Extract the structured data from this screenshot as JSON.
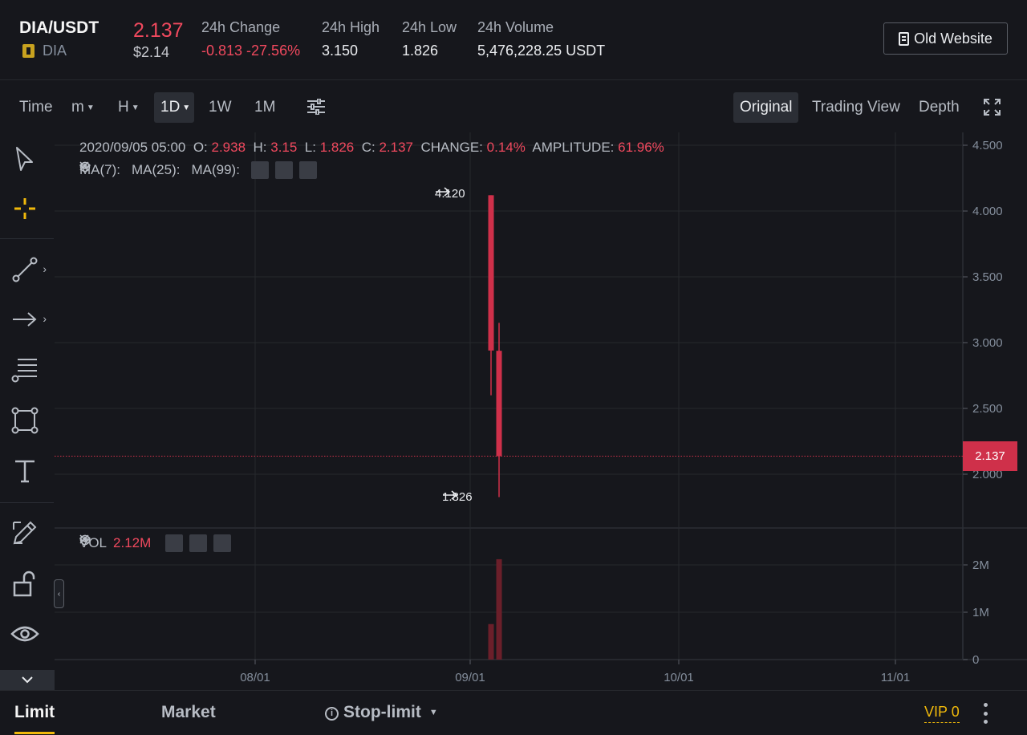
{
  "ticker": {
    "pair": "DIA/USDT",
    "coin": "DIA",
    "last_price": "2.137",
    "last_price_usd": "$2.14",
    "change_label": "24h Change",
    "change_value": "-0.813 -27.56%",
    "high_label": "24h High",
    "high_value": "3.150",
    "low_label": "24h Low",
    "low_value": "1.826",
    "volume_label": "24h Volume",
    "volume_value": "5,476,228.25 USDT",
    "old_website_label": "Old Website"
  },
  "toolbar": {
    "time_label": "Time",
    "intervals": [
      {
        "label": "m",
        "has_caret": true
      },
      {
        "label": "H",
        "has_caret": true
      },
      {
        "label": "1D",
        "has_caret": true,
        "active": true
      },
      {
        "label": "1W"
      },
      {
        "label": "1M"
      }
    ],
    "views": [
      {
        "label": "Original",
        "active": true
      },
      {
        "label": "Trading View"
      },
      {
        "label": "Depth"
      }
    ]
  },
  "sidebar": {
    "tools": [
      "cursor-icon",
      "crosshair-icon",
      "trend-line-icon",
      "arrow-tool-icon",
      "fib-icon",
      "rectangle-icon",
      "text-icon",
      "brush-icon",
      "lock-icon",
      "eye-icon"
    ]
  },
  "chart": {
    "info": {
      "date": "2020/09/05 05:00",
      "o_label": "O:",
      "o": "2.938",
      "h_label": "H:",
      "h": "3.15",
      "l_label": "L:",
      "l": "1.826",
      "c_label": "C:",
      "c": "2.137",
      "change_label": "CHANGE:",
      "change": "0.14%",
      "amplitude_label": "AMPLITUDE:",
      "amplitude": "61.96%"
    },
    "ma": [
      "MA(7):",
      "MA(25):",
      "MA(99):"
    ],
    "vol_label": "VOL",
    "vol_value": "2.12M",
    "high_marker": "4.120",
    "low_marker": "1.826",
    "current_price_tag": "2.137",
    "colors": {
      "down": "#cf304a",
      "grid": "#26282d",
      "accent": "#f0b90b"
    }
  },
  "chart_data": {
    "type": "candlestick",
    "x_ticks": [
      "08/01",
      "09/01",
      "10/01",
      "11/01"
    ],
    "y_ticks": [
      "4.500",
      "4.000",
      "3.500",
      "3.000",
      "2.500",
      "2.000"
    ],
    "ylim": [
      1.8,
      4.5
    ],
    "vol_ticks": [
      "2M",
      "1M",
      "0"
    ],
    "vol_ylim": [
      0,
      2.5
    ],
    "current_price": 2.137,
    "candles": [
      {
        "date": "2020/09/04",
        "open": 4.12,
        "high": 4.12,
        "low": 2.6,
        "close": 2.94,
        "volume": 0.75
      },
      {
        "date": "2020/09/05",
        "open": 2.938,
        "high": 3.15,
        "low": 1.826,
        "close": 2.137,
        "volume": 2.12
      }
    ]
  },
  "order": {
    "tabs": [
      "Limit",
      "Market",
      "Stop-limit"
    ],
    "vip": "VIP 0"
  }
}
